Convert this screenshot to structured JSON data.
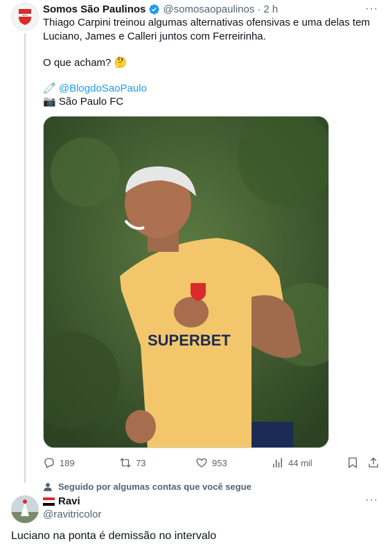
{
  "tweet": {
    "display_name": "Somos São Paulinos",
    "handle": "@somosaopaulinos",
    "separator": "·",
    "time": "2 h",
    "more": "···",
    "line1": "Thiago Carpini treinou algumas alternativas ofensivas e uma delas tem",
    "line2": "Luciano, James e Calleri juntos com Ferreirinha.",
    "question": "O que acham?",
    "question_emoji": "🤔",
    "credit_emoji": "🧷",
    "credit_link": "@BlogdoSaoPaulo",
    "photo_emoji": "📷",
    "photo_credit": "São Paulo FC",
    "image_alt": "Jogador sorrindo com camisa amarela de treino"
  },
  "actions": {
    "replies": "189",
    "retweets": "73",
    "likes": "953",
    "views": "44 mil"
  },
  "social_context": "Seguido por algumas contas que você segue",
  "reply": {
    "display_name": "Ravi",
    "handle": "@ravitricolor",
    "more": "···",
    "text": "Luciano na ponta é demissão no intervalo"
  },
  "colors": {
    "accent": "#1d9bf0",
    "muted": "#536471",
    "jersey": "#f3c66b",
    "background_foliage": "#3f5a2e"
  },
  "icons": [
    "reply-icon",
    "retweet-icon",
    "like-icon",
    "views-icon",
    "bookmark-icon",
    "share-icon",
    "verified-icon",
    "person-icon"
  ]
}
